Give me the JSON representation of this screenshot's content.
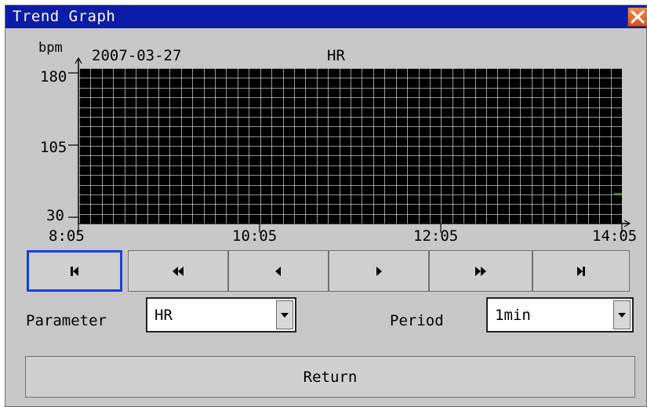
{
  "window": {
    "title": "Trend Graph"
  },
  "graph": {
    "unit": "bpm",
    "date": "2007-03-27",
    "param_label": "HR",
    "y_ticks": [
      "180",
      "105",
      "30"
    ],
    "x_ticks": [
      "8:05",
      "10:05",
      "12:05",
      "14:05"
    ],
    "grid_color": "#ffffff",
    "background": "#000000",
    "trace_color": "#00cc00"
  },
  "nav": {
    "buttons": [
      {
        "name": "first",
        "icon": "skip-to-start-icon",
        "selected": true
      },
      {
        "name": "fast-back",
        "icon": "fast-rewind-icon",
        "selected": false
      },
      {
        "name": "back",
        "icon": "step-back-icon",
        "selected": false
      },
      {
        "name": "forward",
        "icon": "step-forward-icon",
        "selected": false
      },
      {
        "name": "fast-forward",
        "icon": "fast-forward-icon",
        "selected": false
      },
      {
        "name": "last",
        "icon": "skip-to-end-icon",
        "selected": false
      }
    ],
    "selected_color": "#1a3ee0"
  },
  "controls": {
    "parameter_label": "Parameter",
    "parameter_value": "HR",
    "period_label": "Period",
    "period_value": "1min"
  },
  "footer": {
    "return_label": "Return"
  },
  "colors": {
    "titlebar": "#0a1ca8",
    "panel": "#c7c7c7",
    "close": "#e06a2a"
  }
}
